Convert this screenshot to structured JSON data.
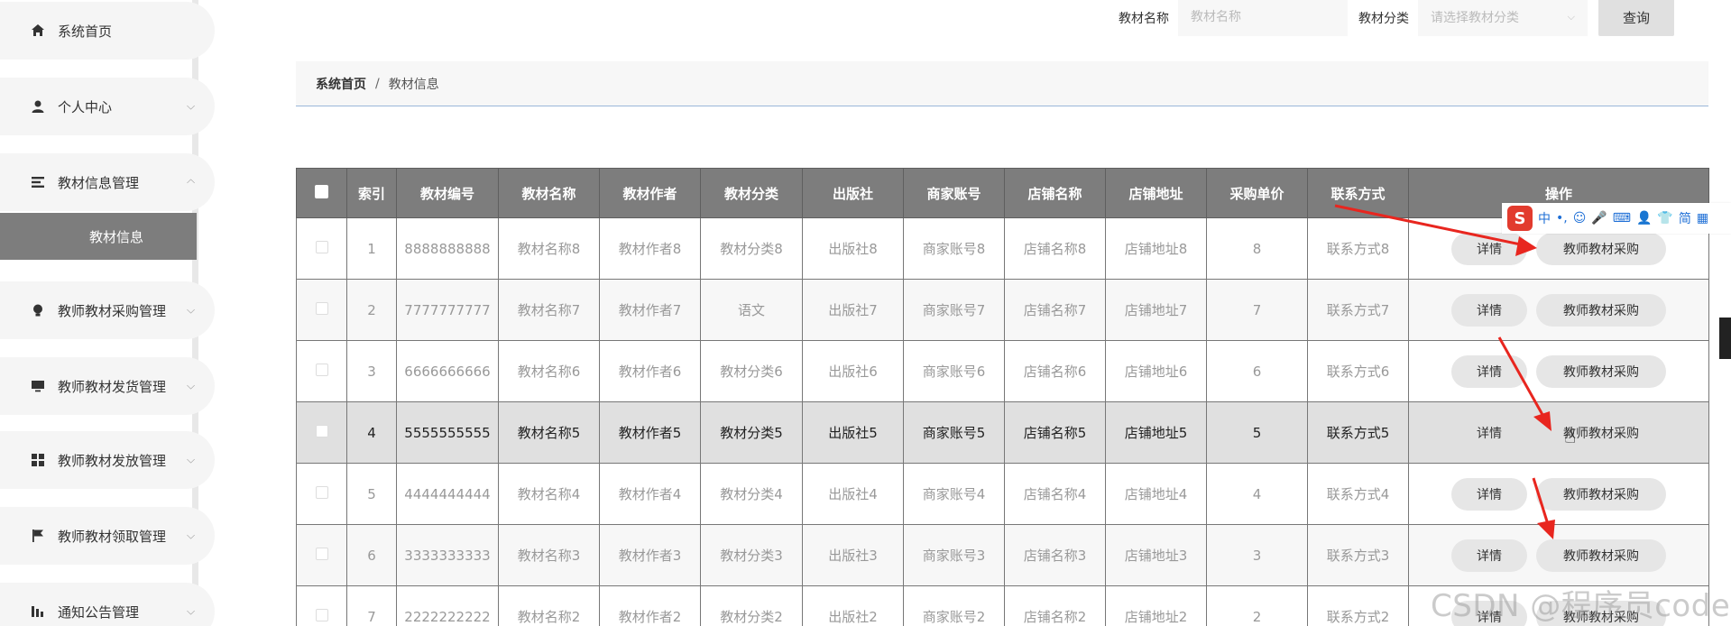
{
  "sidebar": {
    "items": [
      {
        "label": "系统首页",
        "icon": "home-icon"
      },
      {
        "label": "个人中心",
        "icon": "user-icon"
      },
      {
        "label": "教材信息管理",
        "icon": "list-icon"
      },
      {
        "label": "教师教材采购管理",
        "icon": "bulb-icon"
      },
      {
        "label": "教师教材发货管理",
        "icon": "monitor-icon"
      },
      {
        "label": "教师教材发放管理",
        "icon": "grid-icon"
      },
      {
        "label": "教师教材领取管理",
        "icon": "flag-icon"
      },
      {
        "label": "通知公告管理",
        "icon": "chart-icon"
      }
    ],
    "submenu_active": "教材信息"
  },
  "search": {
    "name_label": "教材名称",
    "name_placeholder": "教材名称",
    "category_label": "教材分类",
    "category_placeholder": "请选择教材分类",
    "query_button": "查询"
  },
  "breadcrumb": {
    "home": "系统首页",
    "separator": "/",
    "current": "教材信息"
  },
  "table": {
    "headers": [
      "索引",
      "教材编号",
      "教材名称",
      "教材作者",
      "教材分类",
      "出版社",
      "商家账号",
      "店铺名称",
      "店铺地址",
      "采购单价",
      "联系方式",
      "操作"
    ],
    "detail_button": "详情",
    "buy_button": "教师教材采购",
    "rows": [
      [
        "1",
        "8888888888",
        "教材名称8",
        "教材作者8",
        "教材分类8",
        "出版社8",
        "商家账号8",
        "店铺名称8",
        "店铺地址8",
        "8",
        "联系方式8"
      ],
      [
        "2",
        "7777777777",
        "教材名称7",
        "教材作者7",
        "语文",
        "出版社7",
        "商家账号7",
        "店铺名称7",
        "店铺地址7",
        "7",
        "联系方式7"
      ],
      [
        "3",
        "6666666666",
        "教材名称6",
        "教材作者6",
        "教材分类6",
        "出版社6",
        "商家账号6",
        "店铺名称6",
        "店铺地址6",
        "6",
        "联系方式6"
      ],
      [
        "4",
        "5555555555",
        "教材名称5",
        "教材作者5",
        "教材分类5",
        "出版社5",
        "商家账号5",
        "店铺名称5",
        "店铺地址5",
        "5",
        "联系方式5"
      ],
      [
        "5",
        "4444444444",
        "教材名称4",
        "教材作者4",
        "教材分类4",
        "出版社4",
        "商家账号4",
        "店铺名称4",
        "店铺地址4",
        "4",
        "联系方式4"
      ],
      [
        "6",
        "3333333333",
        "教材名称3",
        "教材作者3",
        "教材分类3",
        "出版社3",
        "商家账号3",
        "店铺名称3",
        "店铺地址3",
        "3",
        "联系方式3"
      ],
      [
        "7",
        "2222222222",
        "教材名称2",
        "教材作者2",
        "教材分类2",
        "出版社2",
        "商家账号2",
        "店铺名称2",
        "店铺地址2",
        "2",
        "联系方式2"
      ]
    ]
  },
  "overlay": {
    "ime_logo": "S",
    "ime_items": [
      "中",
      "•,",
      "☺",
      "🎤",
      "⌨",
      "👤",
      "👕",
      "简",
      "▦"
    ],
    "watermark": "CSDN @程序员code"
  },
  "colors": {
    "header_bg": "#7d7d7d",
    "active_submenu_bg": "#7d7d7d",
    "arrow_red": "#e8261f"
  }
}
